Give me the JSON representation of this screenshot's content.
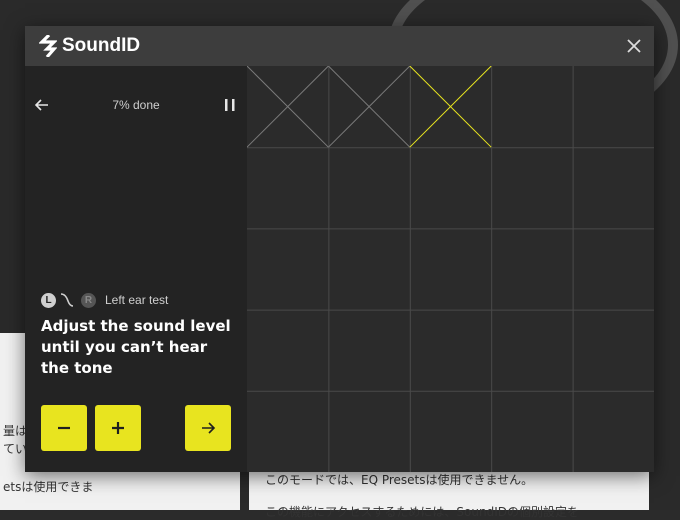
{
  "background": {
    "line1": "量は",
    "line2": "てい",
    "line3": "etsは使用できま",
    "line4": "このモードでは、EQ Presetsは使用できません。",
    "line5": "この機能にアクセスするためには、SoundIDの個別設定を"
  },
  "header": {
    "title": "SoundID",
    "logo_icon": "soundid-logo-icon",
    "close_icon": "close-icon"
  },
  "test": {
    "progress_label": "7% done",
    "progress_fraction": 0.07,
    "ear_left_letter": "L",
    "ear_right_letter": "R",
    "ear_label": "Left ear test",
    "instruction": "Adjust the sound level until you can’t hear the tone"
  },
  "controls": {
    "back_icon": "arrow-left-icon",
    "pause_icon": "pause-icon",
    "decrease_icon": "minus-icon",
    "increase_icon": "plus-icon",
    "next_icon": "arrow-right-icon"
  },
  "grid": {
    "rows": 5,
    "columns": 5,
    "crossed_cells": [
      0,
      1,
      2
    ],
    "active_cell": 2,
    "line_color": "#4a4a4a",
    "cross_color": "#7a7a7a",
    "active_color": "#e8e41f"
  },
  "colors": {
    "accent": "#e8e41f",
    "header_bg": "#3d3d3d",
    "panel_bg": "#232323"
  }
}
